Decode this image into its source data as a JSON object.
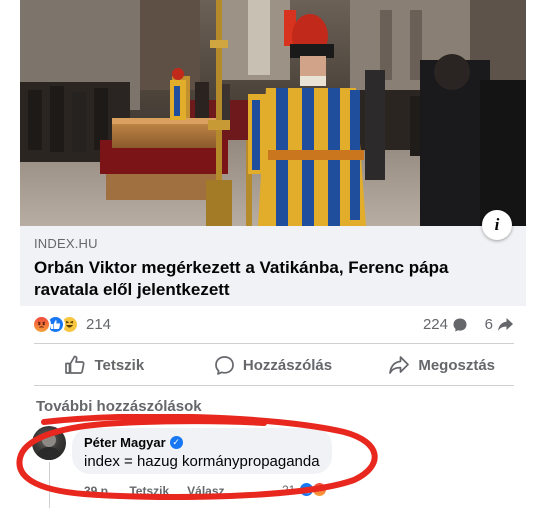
{
  "post": {
    "link": {
      "domain": "INDEX.HU",
      "title": "Orbán Viktor megérkezett a Vatikánba, Ferenc pápa ravatala elől jelentkezett"
    },
    "info_icon": "info-icon",
    "stats": {
      "reaction_icons": [
        "angry-reaction-icon",
        "like-reaction-icon",
        "haha-reaction-icon"
      ],
      "reaction_count": "214",
      "comment_count": "224",
      "share_count": "6"
    },
    "actions": {
      "like_label": "Tetszik",
      "comment_label": "Hozzászólás",
      "share_label": "Megosztás"
    }
  },
  "comments": {
    "more_label": "További hozzászólások",
    "items": [
      {
        "author": "Péter Magyar",
        "verified": true,
        "text": "index = hazug kormánypropaganda",
        "time": "39 p.",
        "like_label": "Tetszik",
        "reply_label": "Válasz",
        "reaction_count": "21"
      }
    ]
  },
  "colors": {
    "accent": "#1877f2",
    "secondary_text": "#65676b",
    "annotation_red": "#e8281f",
    "card_bg": "#f0f2f5"
  }
}
